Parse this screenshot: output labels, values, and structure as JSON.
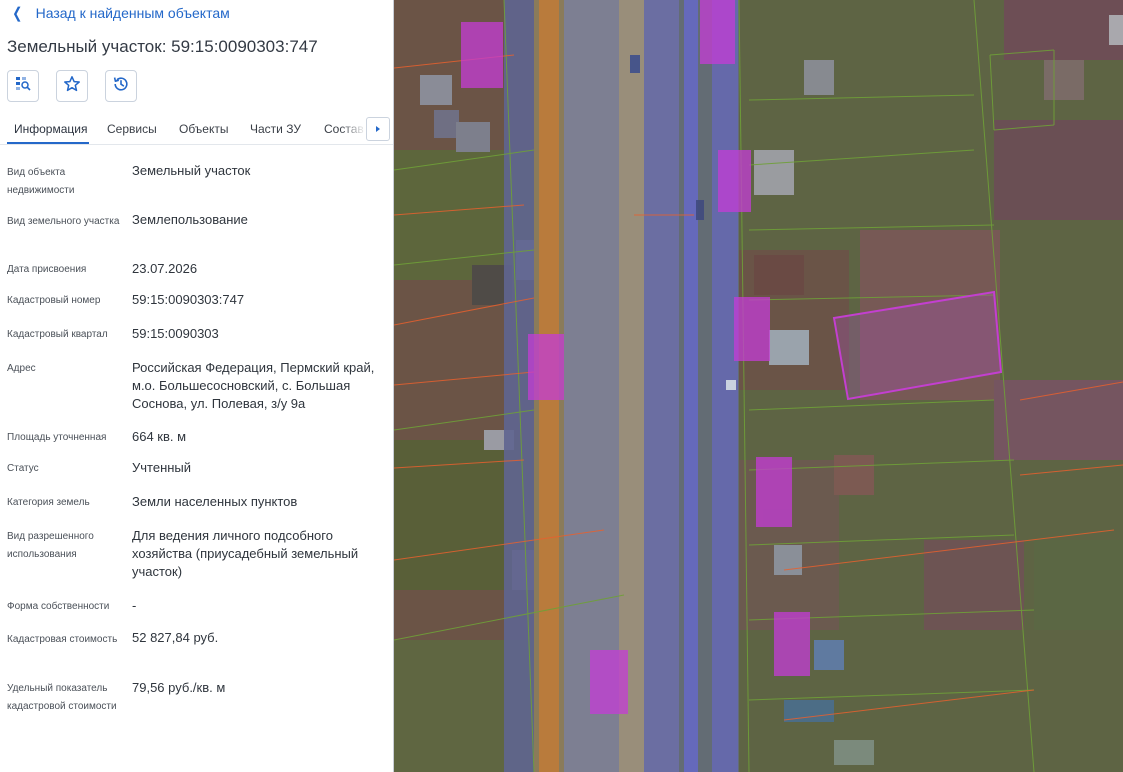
{
  "panel": {
    "back_label": "Назад к найденным объектам",
    "title": "Земельный участок: 59:15:0090303:747",
    "actions": [
      {
        "icon": "locate-on-map-icon"
      },
      {
        "icon": "star-icon"
      },
      {
        "icon": "history-icon"
      }
    ],
    "tabs": [
      "Информация",
      "Сервисы",
      "Объекты",
      "Части ЗУ",
      "Состав"
    ],
    "active_tab": "Информация",
    "fields": [
      {
        "label": "Вид объекта недвижимости",
        "value": "Земельный участок"
      },
      {
        "label": "Вид земельного участка",
        "value": "Землепользование"
      },
      {
        "label": "Дата присвоения",
        "value": "23.07.2026"
      },
      {
        "label": "Кадастровый номер",
        "value": "59:15:0090303:747"
      },
      {
        "label": "Кадастровый квартал",
        "value": "59:15:0090303"
      },
      {
        "label": "Адрес",
        "value": "Российская Федерация, Пермский край, м.о. Большесосновский, с. Большая Соснова, ул. Полевая, з/у 9а"
      },
      {
        "label": "Площадь уточненная",
        "value": "664 кв. м"
      },
      {
        "label": "Статус",
        "value": "Учтенный"
      },
      {
        "label": "Категория земель",
        "value": "Земли населенных пунктов"
      },
      {
        "label": "Вид разрешенного использования",
        "value": "Для ведения личного подсобного хозяйства (приусадебный земельный участок)"
      },
      {
        "label": "Форма собственности",
        "value": "-"
      },
      {
        "label": "Кадастровая стоимость",
        "value": "52 827,84 руб."
      },
      {
        "label": "Удельный показатель кадастровой стоимости",
        "value": "79,56 руб./кв. м"
      }
    ]
  },
  "colors": {
    "accent": "#2468c9",
    "selected_parcel": "#c33fd0",
    "building_overlay": "#c43cd6",
    "road_overlay": "#5b5fe0",
    "zone_line": "#e8602e"
  }
}
